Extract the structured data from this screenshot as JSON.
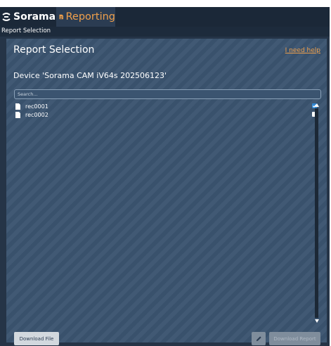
{
  "app": {
    "brand_name": "Sorama",
    "brand_icon": "sorama-logo-icon",
    "active_tab": {
      "label": "Reporting",
      "icon": "report-document-icon"
    }
  },
  "breadcrumb": "Report Selection",
  "panel": {
    "title": "Report Selection",
    "help_link": "I need help",
    "device_title": "Device 'Sorama CAM iV64s 202506123'",
    "search": {
      "placeholder": "Search...",
      "value": ""
    }
  },
  "files": [
    {
      "name": "rec0001",
      "icon": "file-icon",
      "checked": true
    },
    {
      "name": "rec0002",
      "icon": "file-icon",
      "checked": false
    }
  ],
  "footer": {
    "download_file": "Download File",
    "edit_icon": "pencil-icon",
    "download_report": "Download Report"
  },
  "colors": {
    "accent": "#f0a04b",
    "topbar": "#1b2838",
    "panel": "#3b5470",
    "checkbox_checked": "#2f86d3"
  }
}
